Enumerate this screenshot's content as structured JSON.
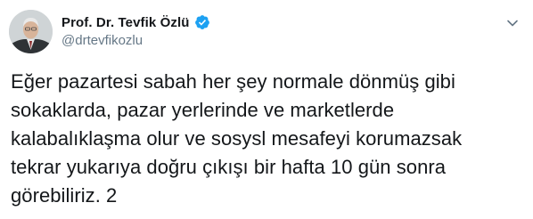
{
  "author": {
    "display_name": "Prof. Dr. Tevfik Özlü",
    "handle": "@drtevfikozlu",
    "verified": true
  },
  "tweet": {
    "text": "Eğer pazartesi sabah her şey normale dönmüş gibi\nsokaklarda, pazar yerlerinde ve marketlerde\nkalabalıklaşma olur ve sosysl mesafeyi korumazsak\ntekrar yukarıya doğru çıkışı bir hafta 10 gün sonra\ngörebiliriz. 2"
  },
  "icons": {
    "verified": "verified-badge-icon",
    "menu": "chevron-down-icon"
  },
  "colors": {
    "text": "#14171a",
    "secondary": "#657786",
    "accent": "#1da1f2"
  }
}
